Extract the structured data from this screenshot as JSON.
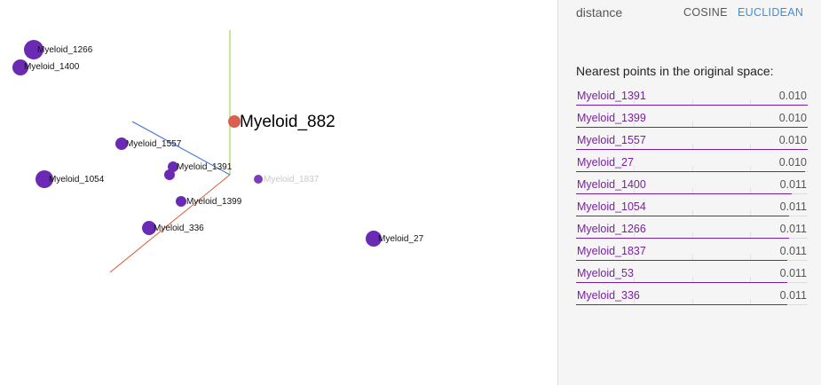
{
  "viewport": {
    "points": [
      {
        "label": "Myeloid_1266",
        "style": "normal"
      },
      {
        "label": "Myeloid_1400",
        "style": "normal"
      },
      {
        "label": "Myeloid_882",
        "style": "selected"
      },
      {
        "label": "Myeloid_1557",
        "style": "normal"
      },
      {
        "label": "Myeloid_1391",
        "style": "normal"
      },
      {
        "label": "Myeloid_1837",
        "style": "faded"
      },
      {
        "label": "Myeloid_1054",
        "style": "normal"
      },
      {
        "label": "Myeloid_1399",
        "style": "normal"
      },
      {
        "label": "Myeloid_336",
        "style": "normal"
      },
      {
        "label": "Myeloid_27",
        "style": "normal"
      }
    ],
    "colors": {
      "point": "#6a2ab3",
      "selected_point": "#d9614f",
      "axis_x": "#e05a3a",
      "axis_y": "#8bd12a",
      "axis_z": "#3a6fd9"
    }
  },
  "panel": {
    "distance": {
      "label": "distance",
      "options": [
        "COSINE",
        "EUCLIDEAN"
      ],
      "selected": "EUCLIDEAN"
    },
    "nearest_title": "Nearest points in the original space:",
    "neighbors": [
      {
        "name": "Myeloid_1391",
        "value": "0.010",
        "fraction": 1.0
      },
      {
        "name": "Myeloid_1399",
        "value": "0.010",
        "fraction": 1.0
      },
      {
        "name": "Myeloid_1557",
        "value": "0.010",
        "fraction": 1.0
      },
      {
        "name": "Myeloid_27",
        "value": "0.010",
        "fraction": 0.99
      },
      {
        "name": "Myeloid_1400",
        "value": "0.011",
        "fraction": 0.93
      },
      {
        "name": "Myeloid_1054",
        "value": "0.011",
        "fraction": 0.92
      },
      {
        "name": "Myeloid_1266",
        "value": "0.011",
        "fraction": 0.92
      },
      {
        "name": "Myeloid_1837",
        "value": "0.011",
        "fraction": 0.91
      },
      {
        "name": "Myeloid_53",
        "value": "0.011",
        "fraction": 0.91
      },
      {
        "name": "Myeloid_336",
        "value": "0.011",
        "fraction": 0.91
      }
    ],
    "colors": {
      "accent": "#7b1fa2",
      "link": "#3b8fdd"
    }
  }
}
